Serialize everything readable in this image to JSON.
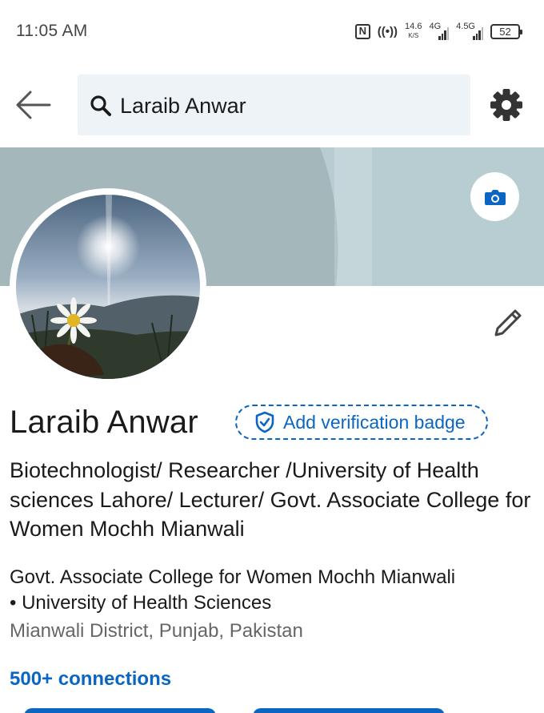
{
  "status_bar": {
    "time": "11:05 AM",
    "network_speed": "14.6",
    "network_speed_unit": "K/S",
    "sim1_type": "4G",
    "sim2_type": "4.5G",
    "battery": "52"
  },
  "search": {
    "query": "Laraib Anwar"
  },
  "profile": {
    "name": "Laraib Anwar",
    "verification_label": "Add verification badge",
    "headline": "Biotechnologist/ Researcher /University of Health sciences Lahore/ Lecturer/ Govt. Associate College for Women Mochh Mianwali",
    "organizations_line1": "Govt. Associate College for Women Mochh Mianwali",
    "organizations_line2": "• University of Health Sciences",
    "location": "Mianwali District, Punjab, Pakistan",
    "connections": "500+ connections"
  },
  "colors": {
    "accent": "#0a66c2",
    "cover_left": "#a4b8bb",
    "cover_right": "#b8cdd2",
    "search_bg": "#eef3f8"
  },
  "icons": {
    "back": "back-arrow-icon",
    "search": "search-icon",
    "settings": "gear-icon",
    "camera": "camera-icon",
    "edit": "pencil-icon",
    "verify": "shield-check-icon"
  }
}
